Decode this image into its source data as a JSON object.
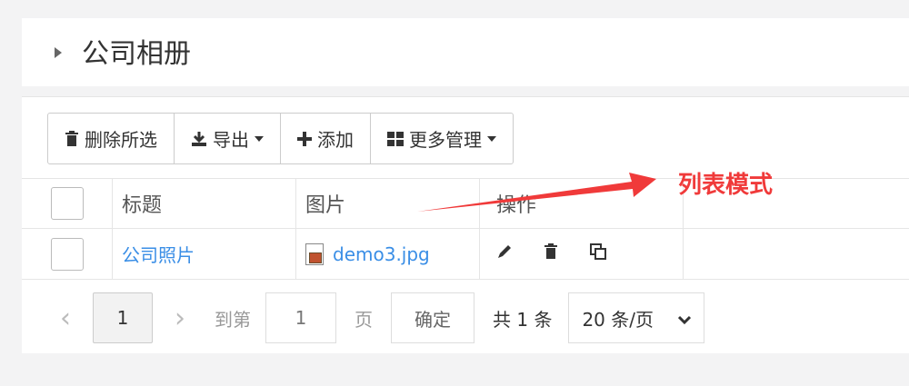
{
  "header": {
    "title": "公司相册"
  },
  "toolbar": {
    "delete_label": "删除所选",
    "export_label": "导出",
    "add_label": "添加",
    "more_label": "更多管理"
  },
  "table": {
    "columns": {
      "title": "标题",
      "image": "图片",
      "ops": "操作"
    },
    "rows": [
      {
        "title": "公司照片",
        "image": "demo3.jpg"
      }
    ]
  },
  "pager": {
    "current": "1",
    "goto_label": "到第",
    "goto_value": "1",
    "page_label": "页",
    "confirm_label": "确定",
    "total": "共 1 条",
    "page_size": "20 条/页"
  },
  "annotation": {
    "text": "列表模式",
    "color": "#f03a3a"
  }
}
